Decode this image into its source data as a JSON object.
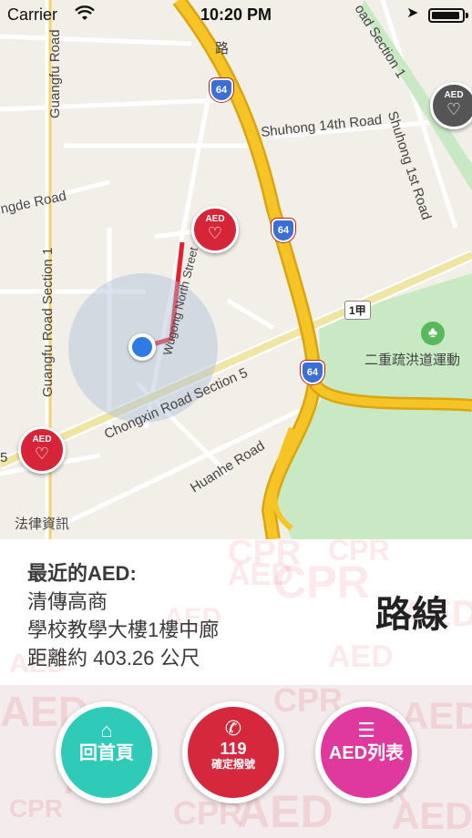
{
  "status_bar": {
    "carrier": "Carrier",
    "wifi_icon": "wifi-icon",
    "time": "10:20 PM",
    "location_icon": "location-arrow-icon",
    "battery_icon": "battery-icon"
  },
  "map": {
    "street_labels": [
      "Guangfu Road",
      "Guangfu Road Section 1",
      "ngde Road",
      "Shuhong 14th Road",
      "Shuhong 1st Road",
      "oad Section 1",
      "Wugong North Street",
      "Chongxin Road Section 5",
      "Huanhe Road",
      "法律資訊",
      "二重疏洪道運動",
      "路",
      "5"
    ],
    "highway_shield": "64",
    "route_badge": "1甲",
    "aed_pin_label": "AED",
    "aed_icon": "aed-heart-icon",
    "park_icon": "tree-icon",
    "colors": {
      "map_bg": "#f2efe8",
      "highway": "#f6c425",
      "park": "#c9e9c4",
      "route_line": "#e3202e",
      "user_dot": "#2f7be6",
      "aed_pin": "#d62438"
    }
  },
  "info": {
    "title": "最近的AED:",
    "place": "清傳高商",
    "location": "學校教學大樓1樓中廊",
    "distance": "距離約 403.26 公尺",
    "route_button": "路線",
    "watermark_words": [
      "CPR",
      "AED"
    ]
  },
  "bottom": {
    "home": {
      "icon": "home-icon",
      "label": "回首頁",
      "color": "#2fcab8"
    },
    "call": {
      "icon": "phone-icon",
      "label": "119",
      "sub": "確定撥號",
      "color": "#d6283c"
    },
    "list": {
      "icon": "list-icon",
      "label": "AED列表",
      "color": "#e0399e"
    }
  }
}
